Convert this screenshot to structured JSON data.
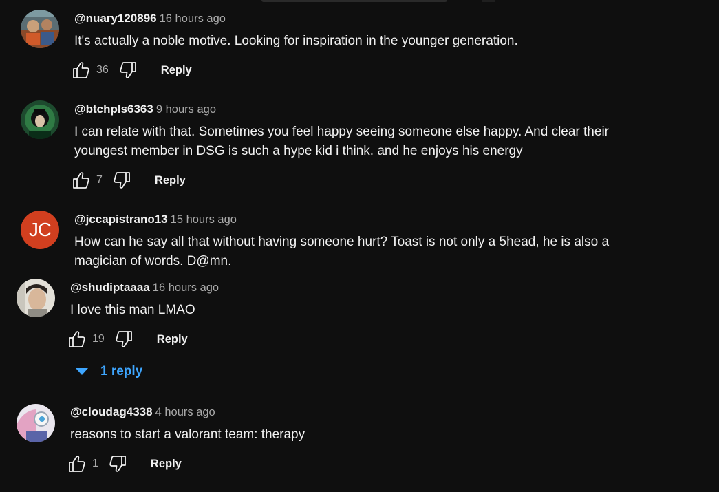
{
  "comments": [
    {
      "author": "@nuary120896",
      "time": "16 hours ago",
      "text": "It's actually a noble motive. Looking for inspiration in the younger generation.",
      "likes": "36",
      "reply_label": "Reply",
      "avatar_icon": "avatar-image"
    },
    {
      "author": "@btchpls6363",
      "time": "9 hours ago",
      "text": "I can relate with that. Sometimes you feel happy seeing someone else happy. And clear their youngest member in DSG is such a hype kid i think. and he enjoys his energy",
      "likes": "7",
      "reply_label": "Reply",
      "avatar_icon": "avatar-image"
    },
    {
      "author": "@jccapistrano13",
      "time": "15 hours ago",
      "text": "How can he say all that without having someone hurt? Toast is not only a 5head, he is also a magician of words. D@mn.",
      "avatar_initials": "JC",
      "avatar_color": "#d13f1f"
    },
    {
      "author": "@shudiptaaaa",
      "time": "16 hours ago",
      "text": "I love this man LMAO",
      "likes": "19",
      "reply_label": "Reply",
      "replies_label": "1 reply",
      "avatar_icon": "avatar-image"
    },
    {
      "author": "@cloudag4338",
      "time": "4 hours ago",
      "text": "reasons to start a valorant team: therapy",
      "likes": "1",
      "reply_label": "Reply",
      "avatar_icon": "avatar-image"
    }
  ],
  "colors": {
    "background": "#0f0f0f",
    "text": "#f1f1f1",
    "muted": "#aaaaaa",
    "link": "#3ea6ff"
  }
}
